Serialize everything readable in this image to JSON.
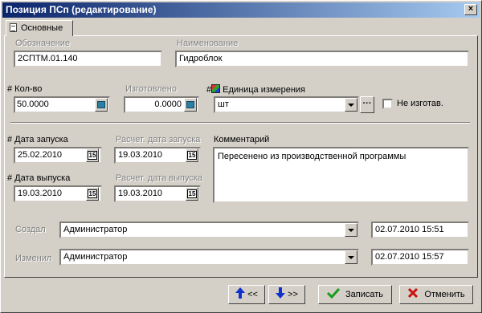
{
  "window": {
    "title": "Позиция ПСп (редактирование)",
    "close_glyph": "×"
  },
  "tab": {
    "label": "Основные"
  },
  "fields": {
    "designation": {
      "label": "Обозначение",
      "value": "2СПТМ.01.140"
    },
    "name": {
      "label": "Наименование",
      "value": "Гидроблок"
    },
    "quantity": {
      "label": "# Кол-во",
      "value": "50.0000"
    },
    "produced": {
      "label": "Изготовлено",
      "value": "0.0000"
    },
    "unit": {
      "label": "Единица измерения",
      "prefix": "#",
      "value": "шт",
      "more_glyph": "···"
    },
    "not_produced": {
      "label": "Не изготав."
    },
    "launch_date": {
      "label": "# Дата запуска",
      "value": "25.02.2010"
    },
    "calc_launch_date": {
      "label": "Расчет. дата запуска",
      "value": "19.03.2010"
    },
    "release_date": {
      "label": "# Дата выпуска",
      "value": "19.03.2010"
    },
    "calc_release_date": {
      "label": "Расчет. дата выпуска",
      "value": "19.03.2010"
    },
    "comment": {
      "label": "Комментарий",
      "value": "Пересенено из производственной программы"
    },
    "created": {
      "label": "Создал",
      "value": "Администратор",
      "timestamp": "02.07.2010 15:51"
    },
    "modified": {
      "label": "Изменил",
      "value": "Администратор",
      "timestamp": "02.07.2010 15:57"
    }
  },
  "calendar_glyph": "15",
  "buttons": {
    "prev": "<<",
    "next": ">>",
    "save": "Записать",
    "cancel": "Отменить"
  },
  "colors": {
    "title_start": "#0a246a",
    "title_end": "#a6caf0",
    "selection": "#0a246a",
    "save_check": "#1a9a1a",
    "cancel_x": "#cc1010",
    "nav_arrow": "#1030d0"
  }
}
